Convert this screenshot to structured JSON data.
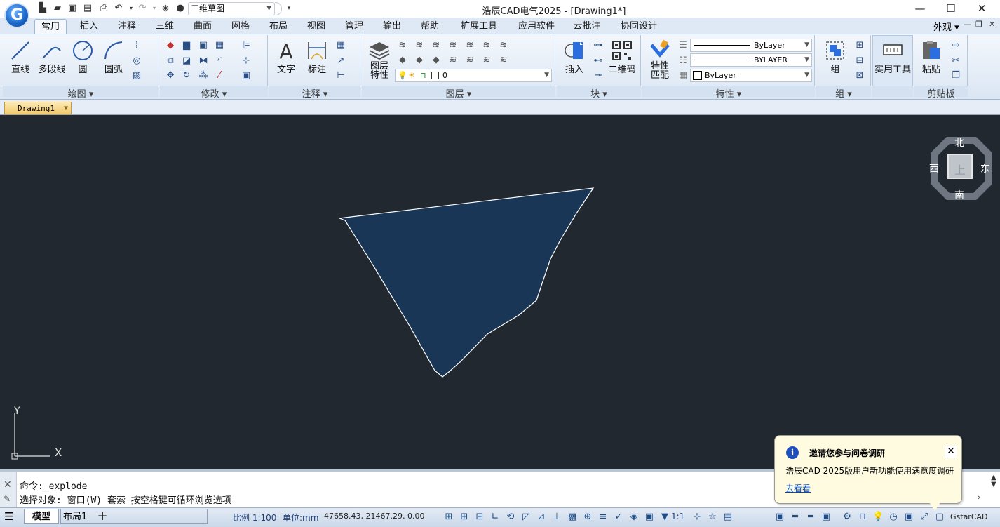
{
  "app": {
    "logo_letter": "G",
    "workspace": "二维草图",
    "window_title": "浩辰CAD电气2025 - [Drawing1*]",
    "appearance": "外观"
  },
  "ribbon": {
    "tabs": [
      "常用",
      "插入",
      "注释",
      "三维",
      "曲面",
      "网格",
      "布局",
      "视图",
      "管理",
      "输出",
      "帮助",
      "扩展工具",
      "应用软件",
      "云批注",
      "协同设计"
    ],
    "active_tab": "常用",
    "draw": {
      "label": "绘图",
      "line": "直线",
      "polyline": "多段线",
      "circle": "圆",
      "arc": "圆弧"
    },
    "modify": {
      "label": "修改"
    },
    "annotate": {
      "label": "注释",
      "text": "文字",
      "dimension": "标注"
    },
    "layers": {
      "label": "图层",
      "layer_props": "图层\n特性",
      "current_layer": "0"
    },
    "block": {
      "label": "块",
      "insert": "插入",
      "qrcode": "二维码"
    },
    "properties": {
      "label": "特性",
      "match": "特性\n匹配",
      "linetype": "ByLayer",
      "lineweight": "BYLAYER",
      "color": "ByLayer"
    },
    "group": {
      "label": "组",
      "group": "组"
    },
    "utilities": {
      "label": "实用工具",
      "label2": "实用工具"
    },
    "clipboard": {
      "label": "剪贴板",
      "paste": "粘贴"
    }
  },
  "document": {
    "tab": "Drawing1"
  },
  "viewcube": {
    "north": "北",
    "south": "南",
    "east": "东",
    "west": "西",
    "top": "上"
  },
  "ucs": {
    "x": "X",
    "y": "Y"
  },
  "command": {
    "line1": "命令:_explode",
    "line2": "选择对象: 窗口(W) 套索  按空格键可循环浏览选项"
  },
  "statusbar": {
    "model": "模型",
    "layout": "布局1",
    "add": "+",
    "scale": "比例 1:100",
    "units": "单位:mm",
    "coords": "47658.43, 21467.29, 0.00",
    "annot_scale": "1:1",
    "brand": "GstarCAD"
  },
  "notification": {
    "title": "邀请您参与问卷调研",
    "message": "浩辰CAD 2025版用户新功能使用满意度调研",
    "link": "去看看"
  },
  "colors": {
    "canvas": "#212830",
    "shape_fill": "#1a3657",
    "shape_stroke": "#ffffff",
    "accent": "#1d4fc1"
  }
}
